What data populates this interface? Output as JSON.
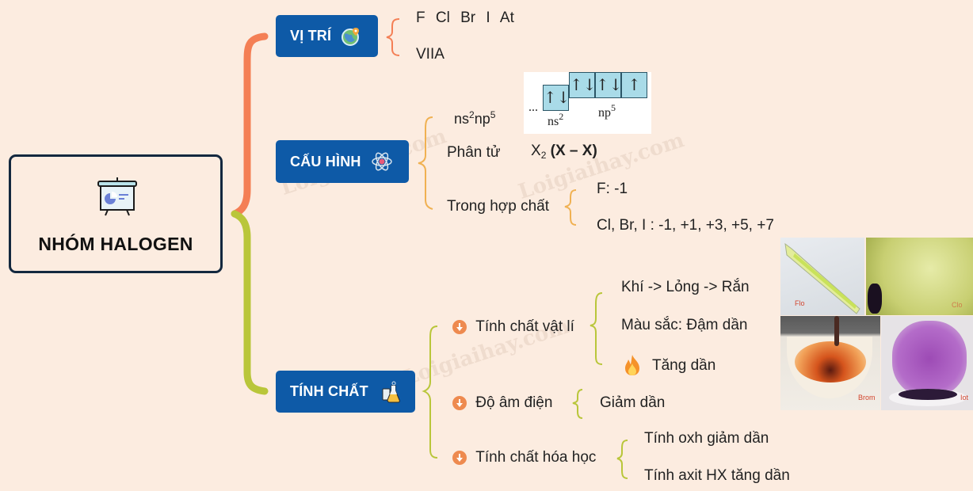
{
  "root": {
    "title": "NHÓM HALOGEN",
    "icon": "presentation-board-icon"
  },
  "colors": {
    "background": "#fcece0",
    "node_fill": "#0e5aa7",
    "brace_orange": "#f47f55",
    "brace_green": "#b9c63a",
    "brace_yellow": "#f0b152",
    "bullet": "#ee8a4f",
    "root_border": "#13283f"
  },
  "branches": {
    "vi_tri": {
      "label": "VỊ TRÍ",
      "icon": "globe-location-icon",
      "items": [
        "F   Cl   Br   I   At",
        "VIIA"
      ]
    },
    "cau_hinh": {
      "label": "CẤU HÌNH",
      "icon": "atom-icon",
      "config": {
        "base": "ns",
        "sup1": "2",
        "mid": "np",
        "sup2": "5"
      },
      "orbital": {
        "dots": "...",
        "ns_label": "ns",
        "ns_sup": "2",
        "np_label": "np",
        "np_sup": "5",
        "ns_boxes": [
          "↑↓"
        ],
        "np_boxes": [
          "↑↓",
          "↑↓",
          "↑"
        ]
      },
      "molecule": {
        "label": "Phân tử",
        "formula_base": "X",
        "formula_sub": "2",
        "formula_bond": "(X – X)"
      },
      "compound": {
        "label": "Trong hợp chất",
        "items": [
          "F: -1",
          "Cl, Br, I : -1, +1, +3, +5, +7"
        ]
      }
    },
    "tinh_chat": {
      "label": "TÍNH CHẤT",
      "icon": "lab-flask-icon",
      "physical": {
        "label": "Tính chất vật lí",
        "items": [
          "Khí -> Lỏng -> Rắn",
          "Màu sắc: Đậm dần",
          "Tăng dần"
        ],
        "item3_icon": "fire-icon"
      },
      "electronegativity": {
        "label": "Độ âm điện",
        "items": [
          "Giảm dần"
        ]
      },
      "chemical": {
        "label": "Tính chất hóa học",
        "items": [
          "Tính oxh giảm dần",
          "Tính axit HX tăng dần"
        ]
      }
    }
  },
  "photos": [
    {
      "label": "Flo"
    },
    {
      "label": "Clo"
    },
    {
      "label": "Brom"
    },
    {
      "label": "Iot"
    }
  ],
  "watermark": "Loigiaihay.com"
}
